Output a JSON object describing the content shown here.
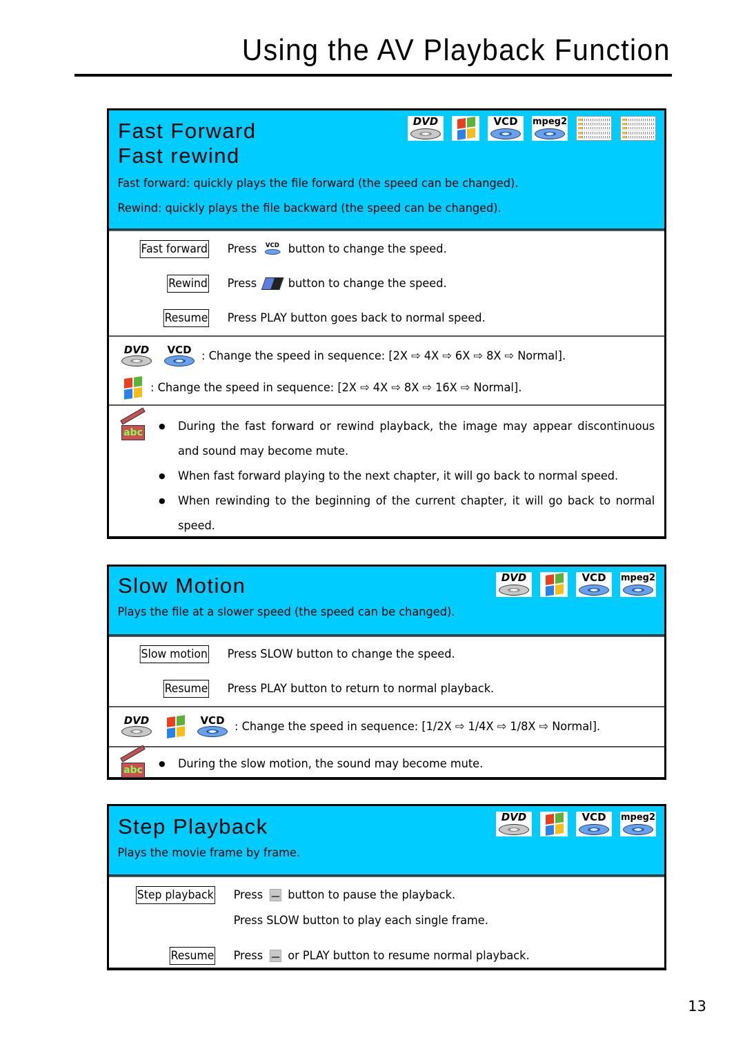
{
  "page": {
    "title": "Using the AV Playback Function",
    "number": "13",
    "accent_color": "#00ccff"
  },
  "format_badges": {
    "dvd": "DVD",
    "windows": "windows-media-icon",
    "vcd": "VCD",
    "mpeg2": "mpeg2"
  },
  "sections": {
    "fast": {
      "title_line1": "Fast Forward",
      "title_line2": "Fast rewind",
      "desc1": "Fast forward: quickly plays the file forward (the speed can be changed).",
      "desc2": "Rewind: quickly plays the file backward (the speed can be changed).",
      "badges": [
        "DVD",
        "windows-media",
        "VCD",
        "mpeg2",
        "file-list-1",
        "file-list-2"
      ],
      "rows": [
        {
          "key": "Fast forward",
          "pre": "Press",
          "icon": "vcd-forward-button-icon",
          "post": "button to change the speed."
        },
        {
          "key": "Rewind",
          "pre": "Press",
          "icon": "rewind-button-icon",
          "post": "button to change the speed."
        },
        {
          "key": "Resume",
          "text": "Press PLAY button goes back to normal speed."
        }
      ],
      "sequences": [
        {
          "formats": [
            "DVD",
            "VCD"
          ],
          "text": ": Change the speed in sequence: [2X ⇨ 4X ⇨ 6X ⇨ 8X ⇨ Normal]."
        },
        {
          "formats": [
            "windows-media"
          ],
          "text": ": Change the speed in sequence: [2X ⇨ 4X ⇨ 8X ⇨ 16X ⇨ Normal]."
        }
      ],
      "notes": [
        "During the fast forward or rewind playback, the image may appear discontinuous and sound may become mute.",
        "When fast forward playing to the next chapter, it will go back to normal speed.",
        "When rewinding to the beginning of the current chapter, it will go back to normal speed."
      ]
    },
    "slow": {
      "title": "Slow Motion",
      "desc": "Plays the file at a slower speed (the speed can be changed).",
      "badges": [
        "DVD",
        "windows-media",
        "VCD",
        "mpeg2"
      ],
      "rows": [
        {
          "key": "Slow motion",
          "text": "Press SLOW button to change the speed."
        },
        {
          "key": "Resume",
          "text": "Press PLAY button to return to normal playback."
        }
      ],
      "sequence": {
        "formats": [
          "DVD",
          "windows-media",
          "VCD"
        ],
        "text": ": Change the speed in sequence: [1/2X ⇨ 1/4X ⇨ 1/8X ⇨ Normal]."
      },
      "notes": [
        "During the slow motion, the sound may become mute."
      ]
    },
    "step": {
      "title": "Step Playback",
      "desc": "Plays the movie frame by frame.",
      "badges": [
        "DVD",
        "windows-media",
        "VCD",
        "mpeg2"
      ],
      "rows": [
        {
          "key": "Step playback",
          "pre": "Press",
          "icon": "pause-button-icon",
          "post": "button to pause the playback."
        },
        {
          "key": "",
          "text": "Press SLOW button to play each single frame."
        },
        {
          "key": "Resume",
          "pre": "Press",
          "icon": "pause-button-icon",
          "post": "or PLAY button to resume normal playback."
        }
      ]
    }
  }
}
